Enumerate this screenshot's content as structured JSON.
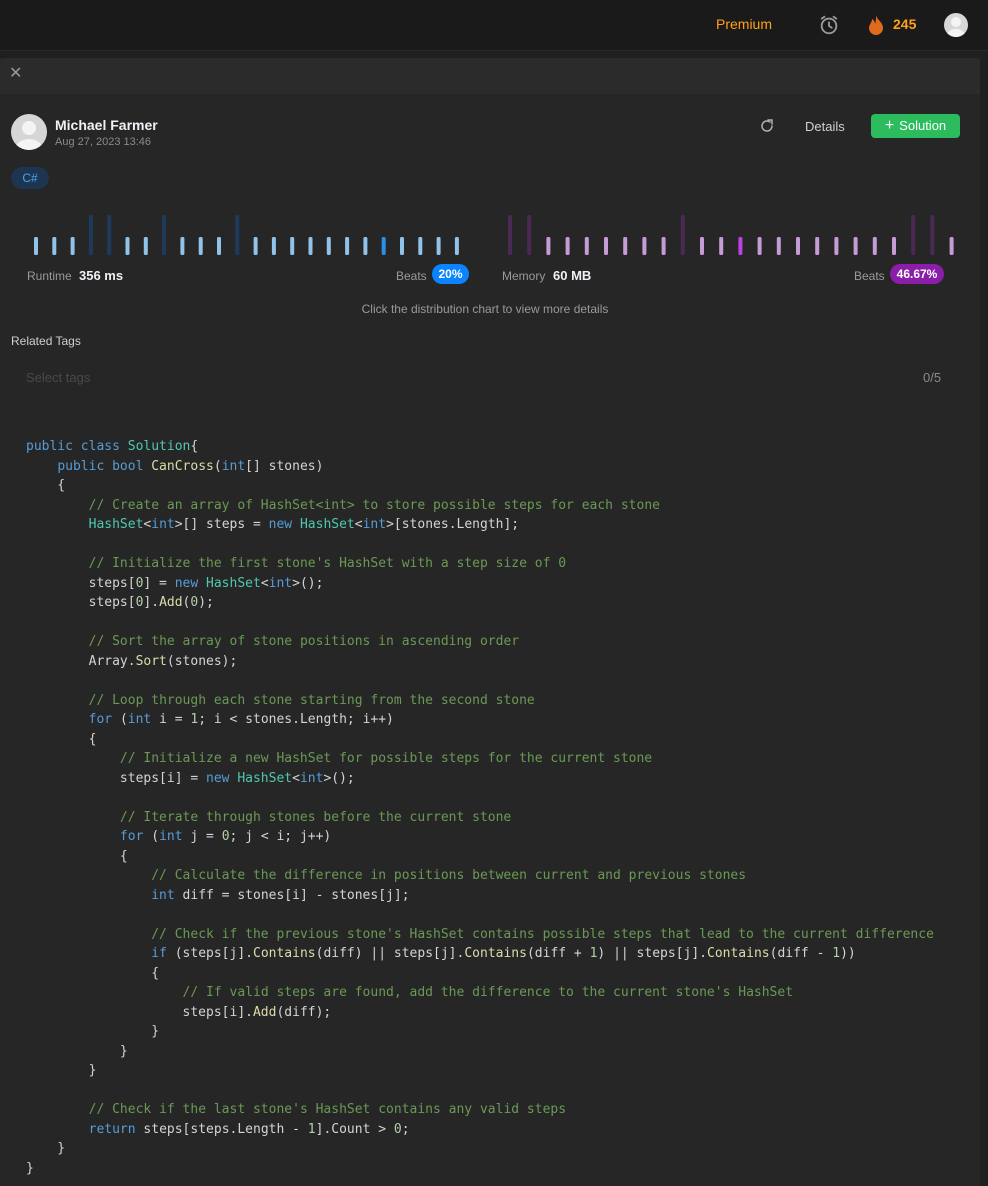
{
  "topbar": {
    "premium_label": "Premium",
    "streak_count": "245",
    "accent_color": "#ffa116"
  },
  "author": {
    "name": "Michael Farmer",
    "date": "Aug 27, 2023 13:46"
  },
  "actions": {
    "details_label": "Details",
    "solution_label": "Solution"
  },
  "language": "C#",
  "runtime": {
    "label": "Runtime",
    "value": "356 ms",
    "beats_label": "Beats",
    "beats": "20%",
    "color": "#0a84ff"
  },
  "memory": {
    "label": "Memory",
    "value": "60 MB",
    "beats_label": "Beats",
    "beats": "46.67%",
    "color": "#a020c0"
  },
  "hint": "Click the distribution chart to view more details",
  "tags": {
    "label": "Related Tags",
    "placeholder": "Select tags",
    "count": "0/5"
  },
  "chart_data": [
    {
      "type": "bar",
      "title": "",
      "values": [
        1,
        1,
        1,
        2,
        2,
        1,
        1,
        2,
        1,
        1,
        1,
        2,
        1,
        1,
        1,
        1,
        1,
        1,
        1,
        1,
        1,
        1,
        1,
        1
      ],
      "highlight_index": 19
    },
    {
      "type": "bar",
      "title": "",
      "values": [
        2,
        2,
        1,
        1,
        1,
        1,
        1,
        1,
        1,
        2,
        1,
        1,
        1,
        1,
        1,
        1,
        1,
        1,
        1,
        1,
        1,
        2,
        2,
        1
      ],
      "highlight_index": 12
    }
  ],
  "code_lines": [
    [
      [
        "kw",
        "public class "
      ],
      [
        "ty",
        "Solution"
      ],
      [
        "",
        "{"
      ]
    ],
    [
      [
        "",
        "    "
      ],
      [
        "kw",
        "public bool "
      ],
      [
        "fn",
        "CanCross"
      ],
      [
        "",
        "("
      ],
      [
        "kw",
        "int"
      ],
      [
        "",
        "[] stones)"
      ]
    ],
    [
      [
        "",
        "    {"
      ]
    ],
    [
      [
        "",
        "        "
      ],
      [
        "cm",
        "// Create an array of HashSet<int> to store possible steps for each stone"
      ]
    ],
    [
      [
        "",
        "        "
      ],
      [
        "ty",
        "HashSet"
      ],
      [
        "",
        "<"
      ],
      [
        "kw",
        "int"
      ],
      [
        "",
        ">[] steps = "
      ],
      [
        "kw",
        "new "
      ],
      [
        "ty",
        "HashSet"
      ],
      [
        "",
        "<"
      ],
      [
        "kw",
        "int"
      ],
      [
        "",
        ">[stones.Length];"
      ]
    ],
    [
      [
        "",
        " "
      ]
    ],
    [
      [
        "",
        "        "
      ],
      [
        "cm",
        "// Initialize the first stone's HashSet with a step size of 0"
      ]
    ],
    [
      [
        "",
        "        steps["
      ],
      [
        "nm",
        "0"
      ],
      [
        "",
        "] = "
      ],
      [
        "kw",
        "new "
      ],
      [
        "ty",
        "HashSet"
      ],
      [
        "",
        "<"
      ],
      [
        "kw",
        "int"
      ],
      [
        "",
        ">();"
      ]
    ],
    [
      [
        "",
        "        steps["
      ],
      [
        "nm",
        "0"
      ],
      [
        "",
        "]."
      ],
      [
        "fn",
        "Add"
      ],
      [
        "",
        "("
      ],
      [
        "nm",
        "0"
      ],
      [
        "",
        ");"
      ]
    ],
    [
      [
        "",
        " "
      ]
    ],
    [
      [
        "",
        "        "
      ],
      [
        "cm",
        "// Sort the array of stone positions in ascending order"
      ]
    ],
    [
      [
        "",
        "        Array."
      ],
      [
        "fn",
        "Sort"
      ],
      [
        "",
        "(stones);"
      ]
    ],
    [
      [
        "",
        " "
      ]
    ],
    [
      [
        "",
        "        "
      ],
      [
        "cm",
        "// Loop through each stone starting from the second stone"
      ]
    ],
    [
      [
        "",
        "        "
      ],
      [
        "kw",
        "for "
      ],
      [
        "",
        "("
      ],
      [
        "kw",
        "int "
      ],
      [
        "",
        "i = "
      ],
      [
        "nm",
        "1"
      ],
      [
        "",
        "; i < stones.Length; i++)"
      ]
    ],
    [
      [
        "",
        "        {"
      ]
    ],
    [
      [
        "",
        "            "
      ],
      [
        "cm",
        "// Initialize a new HashSet for possible steps for the current stone"
      ]
    ],
    [
      [
        "",
        "            steps[i] = "
      ],
      [
        "kw",
        "new "
      ],
      [
        "ty",
        "HashSet"
      ],
      [
        "",
        "<"
      ],
      [
        "kw",
        "int"
      ],
      [
        "",
        ">();"
      ]
    ],
    [
      [
        "",
        " "
      ]
    ],
    [
      [
        "",
        "            "
      ],
      [
        "cm",
        "// Iterate through stones before the current stone"
      ]
    ],
    [
      [
        "",
        "            "
      ],
      [
        "kw",
        "for "
      ],
      [
        "",
        "("
      ],
      [
        "kw",
        "int "
      ],
      [
        "",
        "j = "
      ],
      [
        "nm",
        "0"
      ],
      [
        "",
        "; j < i; j++)"
      ]
    ],
    [
      [
        "",
        "            {"
      ]
    ],
    [
      [
        "",
        "                "
      ],
      [
        "cm",
        "// Calculate the difference in positions between current and previous stones"
      ]
    ],
    [
      [
        "",
        "                "
      ],
      [
        "kw",
        "int "
      ],
      [
        "",
        "diff = stones[i] - stones[j];"
      ]
    ],
    [
      [
        "",
        " "
      ]
    ],
    [
      [
        "",
        "                "
      ],
      [
        "cm",
        "// Check if the previous stone's HashSet contains possible steps that lead to the current difference"
      ]
    ],
    [
      [
        "",
        "                "
      ],
      [
        "kw",
        "if "
      ],
      [
        "",
        "(steps[j]."
      ],
      [
        "fn",
        "Contains"
      ],
      [
        "",
        "(diff) || steps[j]."
      ],
      [
        "fn",
        "Contains"
      ],
      [
        "",
        "(diff + "
      ],
      [
        "nm",
        "1"
      ],
      [
        "",
        ") || steps[j]."
      ],
      [
        "fn",
        "Contains"
      ],
      [
        "",
        "(diff - "
      ],
      [
        "nm",
        "1"
      ],
      [
        "",
        "))"
      ]
    ],
    [
      [
        "",
        "                {"
      ]
    ],
    [
      [
        "",
        "                    "
      ],
      [
        "cm",
        "// If valid steps are found, add the difference to the current stone's HashSet"
      ]
    ],
    [
      [
        "",
        "                    steps[i]."
      ],
      [
        "fn",
        "Add"
      ],
      [
        "",
        "(diff);"
      ]
    ],
    [
      [
        "",
        "                }"
      ]
    ],
    [
      [
        "",
        "            }"
      ]
    ],
    [
      [
        "",
        "        }"
      ]
    ],
    [
      [
        "",
        " "
      ]
    ],
    [
      [
        "",
        "        "
      ],
      [
        "cm",
        "// Check if the last stone's HashSet contains any valid steps"
      ]
    ],
    [
      [
        "",
        "        "
      ],
      [
        "kw",
        "return "
      ],
      [
        "",
        "steps[steps.Length - "
      ],
      [
        "nm",
        "1"
      ],
      [
        "",
        "].Count > "
      ],
      [
        "nm",
        "0"
      ],
      [
        "",
        ";"
      ]
    ],
    [
      [
        "",
        "    }"
      ]
    ],
    [
      [
        "",
        "}"
      ]
    ]
  ]
}
